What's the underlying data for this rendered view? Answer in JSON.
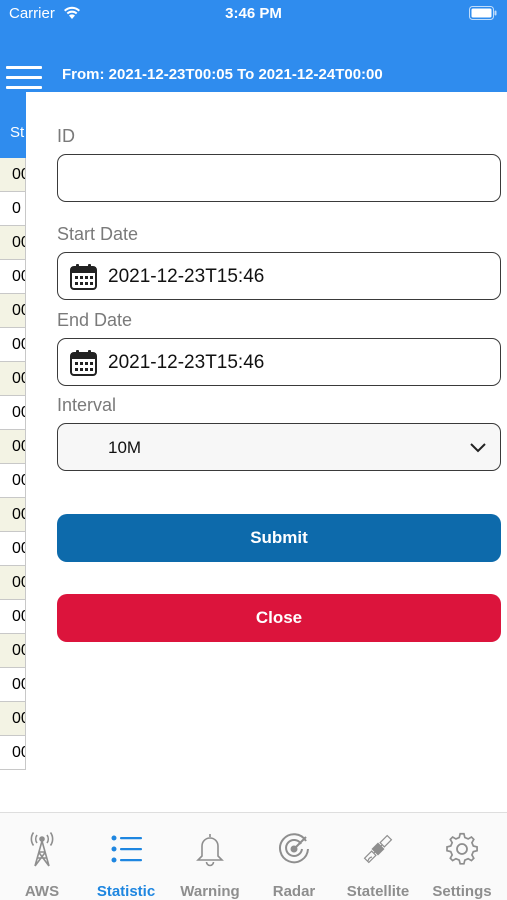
{
  "status": {
    "carrier": "Carrier",
    "time": "3:46 PM"
  },
  "header": {
    "range": "From: 2021-12-23T00:05 To 2021-12-24T00:00"
  },
  "background_table": {
    "header": "St",
    "rows": [
      "00",
      "0",
      "00",
      "00",
      "00",
      "00",
      "00",
      "00",
      "00",
      "00",
      "00",
      "00",
      "00",
      "00",
      "00",
      "00",
      "00",
      "00"
    ]
  },
  "form": {
    "id_label": "ID",
    "id_value": "",
    "start_label": "Start Date",
    "start_value": "2021-12-23T15:46",
    "end_label": "End Date",
    "end_value": "2021-12-23T15:46",
    "interval_label": "Interval",
    "interval_value": "10M",
    "submit": "Submit",
    "close": "Close"
  },
  "tabs": [
    {
      "label": "AWS",
      "icon": "tower-icon"
    },
    {
      "label": "Statistic",
      "icon": "list-icon",
      "active": true
    },
    {
      "label": "Warning",
      "icon": "bell-icon"
    },
    {
      "label": "Radar",
      "icon": "radar-icon"
    },
    {
      "label": "Statellite",
      "icon": "satellite-icon"
    },
    {
      "label": "Settings",
      "icon": "gear-icon"
    }
  ],
  "colors": {
    "header": "#2f8cee",
    "submit": "#0d6aab",
    "close": "#dc143c",
    "tab_active": "#1e86e0",
    "tab_inactive": "#8e8e8e"
  }
}
